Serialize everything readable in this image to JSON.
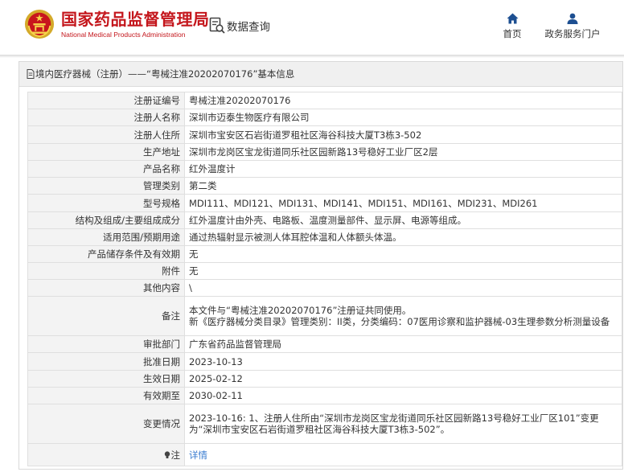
{
  "header": {
    "brand_cn": "国家药品监督管理局",
    "brand_en": "National Medical Products Administration",
    "query_label": "数据查询",
    "nav": [
      {
        "label": "首页",
        "icon": "home-icon"
      },
      {
        "label": "政务服务门户",
        "icon": "user-icon"
      }
    ]
  },
  "panel": {
    "title": "境内医疗器械（注册）——“粤械注准20202070176”基本信息"
  },
  "rows": [
    {
      "key": "注册证编号",
      "value": "粤械注准20202070176"
    },
    {
      "key": "注册人名称",
      "value": "深圳市迈泰生物医疗有限公司"
    },
    {
      "key": "注册人住所",
      "value": "深圳市宝安区石岩街道罗租社区海谷科技大厦T3栋3-502"
    },
    {
      "key": "生产地址",
      "value": "深圳市龙岗区宝龙街道同乐社区园新路13号稳好工业厂区2层"
    },
    {
      "key": "产品名称",
      "value": "红外温度计"
    },
    {
      "key": "管理类别",
      "value": "第二类"
    },
    {
      "key": "型号规格",
      "value": "MDI111、MDI121、MDI131、MDI141、MDI151、MDI161、MDI231、MDI261"
    },
    {
      "key": "结构及组成/主要组成成分",
      "value": "红外温度计由外壳、电路板、温度测量部件、显示屏、电源等组成。"
    },
    {
      "key": "适用范围/预期用途",
      "value": "通过热辐射显示被测人体耳腔体温和人体额头体温。"
    },
    {
      "key": "产品储存条件及有效期",
      "value": "无"
    },
    {
      "key": "附件",
      "value": "无"
    },
    {
      "key": "其他内容",
      "value": "\\"
    },
    {
      "key": "备注",
      "value": "本文件与“粤械注准20202070176”注册证共同使用。\n新《医疗器械分类目录》管理类别：II类，分类编码：07医用诊察和监护器械-03生理参数分析测量设备"
    },
    {
      "key": "审批部门",
      "value": "广东省药品监督管理局"
    },
    {
      "key": "批准日期",
      "value": "2023-10-13"
    },
    {
      "key": "生效日期",
      "value": "2025-02-12"
    },
    {
      "key": "有效期至",
      "value": "2030-02-11"
    },
    {
      "key": "变更情况",
      "value": "2023-10-16: 1、注册人住所由“深圳市龙岗区宝龙街道同乐社区园新路13号稳好工业厂区101”变更为“深圳市宝安区石岩街道罗租社区海谷科技大厦T3栋3-502”。"
    },
    {
      "key": "注",
      "value": "详情"
    }
  ],
  "colors": {
    "brand_red": "#c4161c",
    "nav_blue": "#1d4f91",
    "link_blue": "#3a7cd0"
  }
}
